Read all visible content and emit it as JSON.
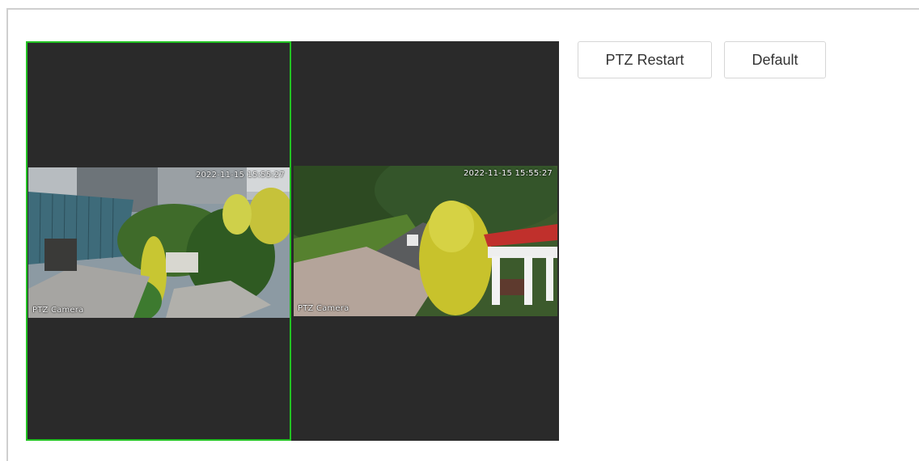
{
  "toolbar": {
    "ptz_restart_label": "PTZ Restart",
    "default_label": "Default"
  },
  "viewer": {
    "channels": [
      {
        "selected": true,
        "osd_time": "2022-11-15 15:55:27",
        "osd_name": "PTZ Camera"
      },
      {
        "selected": false,
        "osd_time": "2022-11-15 15:55:27",
        "osd_name": "PTZ Camera"
      }
    ]
  },
  "colors": {
    "selected_border": "#22c322",
    "viewer_background": "#2a2a2a",
    "frame_border": "#cfcfcf"
  }
}
